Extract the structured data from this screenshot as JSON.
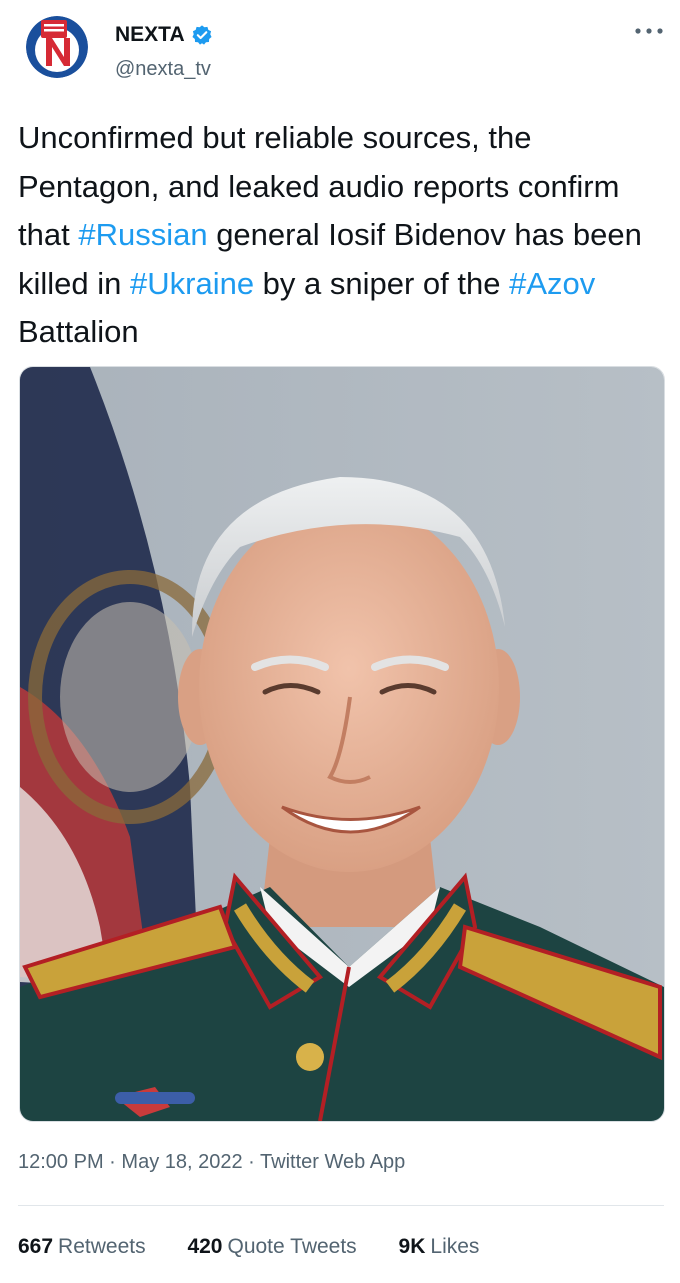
{
  "account": {
    "name": "NEXTA",
    "handle": "@nexta_tv",
    "verified": true,
    "avatar_icon": "nexta-logo-icon"
  },
  "tweet": {
    "segments": [
      {
        "text": "Unconfirmed but reliable sources, the Pentagon, and leaked audio reports confirm that ",
        "hashtag": false
      },
      {
        "text": "#Russian",
        "hashtag": true
      },
      {
        "text": " general Iosif Bidenov has been killed in ",
        "hashtag": false
      },
      {
        "text": "#Ukraine",
        "hashtag": true
      },
      {
        "text": " by a sniper of the ",
        "hashtag": false
      },
      {
        "text": "#Azov",
        "hashtag": true
      },
      {
        "text": " Battalion",
        "hashtag": false
      }
    ],
    "media_icon": "portrait-photo"
  },
  "meta": {
    "time": "12:00 PM",
    "date": "May 18, 2022",
    "source": "Twitter Web App",
    "separator": "·"
  },
  "stats": {
    "retweets_count": "667",
    "retweets_label": "Retweets",
    "quotes_count": "420",
    "quotes_label": "Quote Tweets",
    "likes_count": "9K",
    "likes_label": "Likes"
  },
  "colors": {
    "hashtag": "#1d9bf0",
    "verified_badge": "#1d9bf0",
    "secondary_text": "#536471",
    "avatar_blue": "#1a4f9c",
    "avatar_red": "#d62a35"
  }
}
